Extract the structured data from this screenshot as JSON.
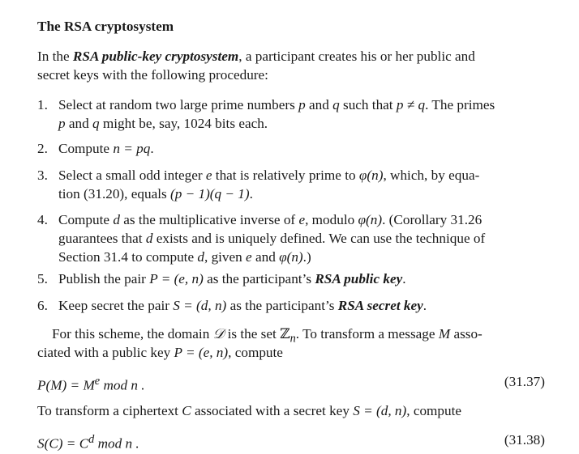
{
  "section": {
    "title": "The RSA cryptosystem"
  },
  "intro": {
    "prefix": "In the ",
    "term": "RSA public-key cryptosystem",
    "rest_line1": ", a participant creates his or her public and",
    "line2": "secret keys with the following procedure:"
  },
  "steps": [
    {
      "num": "1.",
      "l1a": "Select at random two large prime numbers ",
      "p": "p",
      "and": " and ",
      "q": "q",
      "l1b": " such that ",
      "neq": "p ≠ q",
      "l1c": ". The primes",
      "l2a": "p",
      "l2b": " and ",
      "l2c": "q",
      "l2d": " might be, say, 1024 bits each."
    },
    {
      "num": "2.",
      "text": "Compute ",
      "math": "n = pq",
      "end": "."
    },
    {
      "num": "3.",
      "l1a": "Select a small odd integer ",
      "e": "e",
      "l1b": " that is relatively prime to ",
      "phi": "φ(n)",
      "l1c": ", which, by equa-",
      "l2a": "tion (31.20), equals ",
      "math": "(p − 1)(q − 1)",
      "l2b": "."
    },
    {
      "num": "4.",
      "l1a": "Compute ",
      "d": "d",
      "l1b": " as the multiplicative inverse of ",
      "e": "e",
      "l1c": ", modulo ",
      "phi": "φ(n)",
      "l1d": ". (Corollary 31.26",
      "l2a": "guarantees that ",
      "d2": "d",
      "l2b": " exists and is uniquely defined. We can use the technique of",
      "l3a": "Section 31.4 to compute ",
      "d3": "d",
      "l3b": ", given ",
      "e3": "e",
      "l3c": " and ",
      "phi3": "φ(n)",
      "l3d": ".)"
    },
    {
      "num": "5.",
      "a": "Publish the pair ",
      "math": "P = (e, n)",
      "b": " as the participant’s ",
      "term": "RSA public key",
      "c": "."
    },
    {
      "num": "6.",
      "a": "Keep secret the pair ",
      "math": "S = (d, n)",
      "b": " as the participant’s ",
      "term": "RSA secret key",
      "c": "."
    }
  ],
  "para2": {
    "l1a": "For this scheme, the domain ",
    "D": "𝒟",
    "l1b": " is the set ",
    "Zn": "ℤ",
    "Zsub": "n",
    "l1c": ". To transform a message ",
    "M": "M",
    "l1d": " asso-",
    "l2a": "ciated with a public key ",
    "math": "P = (e, n)",
    "l2b": ", compute"
  },
  "eq1": {
    "lhs": "P(M) = M",
    "sup": "e",
    "rhs": " mod n .",
    "label": "(31.37)"
  },
  "para3": {
    "a": "To transform a ciphertext ",
    "C": "C",
    "b": " associated with a secret key ",
    "math": "S = (d, n)",
    "c": ", compute"
  },
  "eq2": {
    "lhs": "S(C) = C",
    "sup": "d",
    "rhs": " mod n .",
    "label": "(31.38)"
  }
}
